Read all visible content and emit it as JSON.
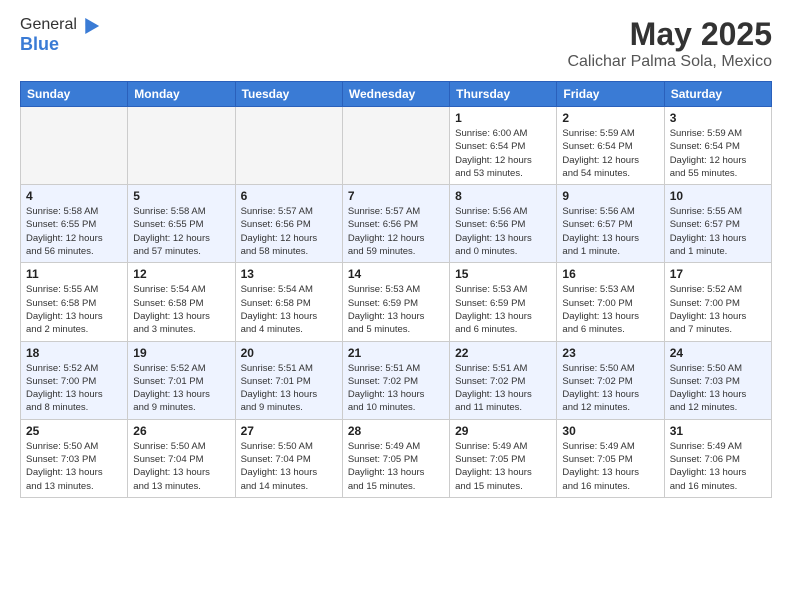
{
  "header": {
    "logo_general": "General",
    "logo_blue": "Blue",
    "title": "May 2025",
    "subtitle": "Calichar Palma Sola, Mexico"
  },
  "days": [
    "Sunday",
    "Monday",
    "Tuesday",
    "Wednesday",
    "Thursday",
    "Friday",
    "Saturday"
  ],
  "weeks": [
    [
      {
        "date": "",
        "info": ""
      },
      {
        "date": "",
        "info": ""
      },
      {
        "date": "",
        "info": ""
      },
      {
        "date": "",
        "info": ""
      },
      {
        "date": "1",
        "info": "Sunrise: 6:00 AM\nSunset: 6:54 PM\nDaylight: 12 hours\nand 53 minutes."
      },
      {
        "date": "2",
        "info": "Sunrise: 5:59 AM\nSunset: 6:54 PM\nDaylight: 12 hours\nand 54 minutes."
      },
      {
        "date": "3",
        "info": "Sunrise: 5:59 AM\nSunset: 6:54 PM\nDaylight: 12 hours\nand 55 minutes."
      }
    ],
    [
      {
        "date": "4",
        "info": "Sunrise: 5:58 AM\nSunset: 6:55 PM\nDaylight: 12 hours\nand 56 minutes."
      },
      {
        "date": "5",
        "info": "Sunrise: 5:58 AM\nSunset: 6:55 PM\nDaylight: 12 hours\nand 57 minutes."
      },
      {
        "date": "6",
        "info": "Sunrise: 5:57 AM\nSunset: 6:56 PM\nDaylight: 12 hours\nand 58 minutes."
      },
      {
        "date": "7",
        "info": "Sunrise: 5:57 AM\nSunset: 6:56 PM\nDaylight: 12 hours\nand 59 minutes."
      },
      {
        "date": "8",
        "info": "Sunrise: 5:56 AM\nSunset: 6:56 PM\nDaylight: 13 hours\nand 0 minutes."
      },
      {
        "date": "9",
        "info": "Sunrise: 5:56 AM\nSunset: 6:57 PM\nDaylight: 13 hours\nand 1 minute."
      },
      {
        "date": "10",
        "info": "Sunrise: 5:55 AM\nSunset: 6:57 PM\nDaylight: 13 hours\nand 1 minute."
      }
    ],
    [
      {
        "date": "11",
        "info": "Sunrise: 5:55 AM\nSunset: 6:58 PM\nDaylight: 13 hours\nand 2 minutes."
      },
      {
        "date": "12",
        "info": "Sunrise: 5:54 AM\nSunset: 6:58 PM\nDaylight: 13 hours\nand 3 minutes."
      },
      {
        "date": "13",
        "info": "Sunrise: 5:54 AM\nSunset: 6:58 PM\nDaylight: 13 hours\nand 4 minutes."
      },
      {
        "date": "14",
        "info": "Sunrise: 5:53 AM\nSunset: 6:59 PM\nDaylight: 13 hours\nand 5 minutes."
      },
      {
        "date": "15",
        "info": "Sunrise: 5:53 AM\nSunset: 6:59 PM\nDaylight: 13 hours\nand 6 minutes."
      },
      {
        "date": "16",
        "info": "Sunrise: 5:53 AM\nSunset: 7:00 PM\nDaylight: 13 hours\nand 6 minutes."
      },
      {
        "date": "17",
        "info": "Sunrise: 5:52 AM\nSunset: 7:00 PM\nDaylight: 13 hours\nand 7 minutes."
      }
    ],
    [
      {
        "date": "18",
        "info": "Sunrise: 5:52 AM\nSunset: 7:00 PM\nDaylight: 13 hours\nand 8 minutes."
      },
      {
        "date": "19",
        "info": "Sunrise: 5:52 AM\nSunset: 7:01 PM\nDaylight: 13 hours\nand 9 minutes."
      },
      {
        "date": "20",
        "info": "Sunrise: 5:51 AM\nSunset: 7:01 PM\nDaylight: 13 hours\nand 9 minutes."
      },
      {
        "date": "21",
        "info": "Sunrise: 5:51 AM\nSunset: 7:02 PM\nDaylight: 13 hours\nand 10 minutes."
      },
      {
        "date": "22",
        "info": "Sunrise: 5:51 AM\nSunset: 7:02 PM\nDaylight: 13 hours\nand 11 minutes."
      },
      {
        "date": "23",
        "info": "Sunrise: 5:50 AM\nSunset: 7:02 PM\nDaylight: 13 hours\nand 12 minutes."
      },
      {
        "date": "24",
        "info": "Sunrise: 5:50 AM\nSunset: 7:03 PM\nDaylight: 13 hours\nand 12 minutes."
      }
    ],
    [
      {
        "date": "25",
        "info": "Sunrise: 5:50 AM\nSunset: 7:03 PM\nDaylight: 13 hours\nand 13 minutes."
      },
      {
        "date": "26",
        "info": "Sunrise: 5:50 AM\nSunset: 7:04 PM\nDaylight: 13 hours\nand 13 minutes."
      },
      {
        "date": "27",
        "info": "Sunrise: 5:50 AM\nSunset: 7:04 PM\nDaylight: 13 hours\nand 14 minutes."
      },
      {
        "date": "28",
        "info": "Sunrise: 5:49 AM\nSunset: 7:05 PM\nDaylight: 13 hours\nand 15 minutes."
      },
      {
        "date": "29",
        "info": "Sunrise: 5:49 AM\nSunset: 7:05 PM\nDaylight: 13 hours\nand 15 minutes."
      },
      {
        "date": "30",
        "info": "Sunrise: 5:49 AM\nSunset: 7:05 PM\nDaylight: 13 hours\nand 16 minutes."
      },
      {
        "date": "31",
        "info": "Sunrise: 5:49 AM\nSunset: 7:06 PM\nDaylight: 13 hours\nand 16 minutes."
      }
    ]
  ]
}
